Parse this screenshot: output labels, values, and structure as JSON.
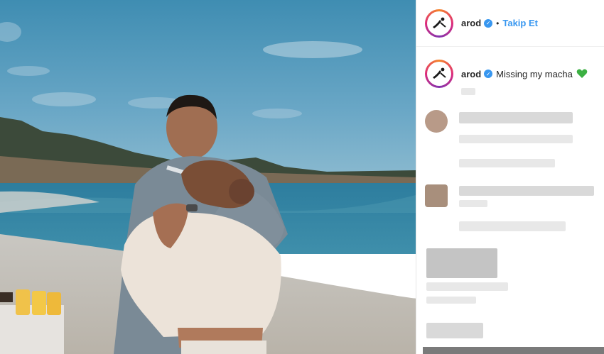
{
  "post": {
    "author": "arod",
    "follow_label": "Takip Et",
    "caption_author": "arod",
    "caption_text": "Missing my macha"
  },
  "colors": {
    "link": "#3897f0",
    "verified": "#3897f0",
    "heart": "#3cb043"
  },
  "icons": {
    "verified": "verified-badge-icon",
    "heart": "green-heart-icon"
  }
}
